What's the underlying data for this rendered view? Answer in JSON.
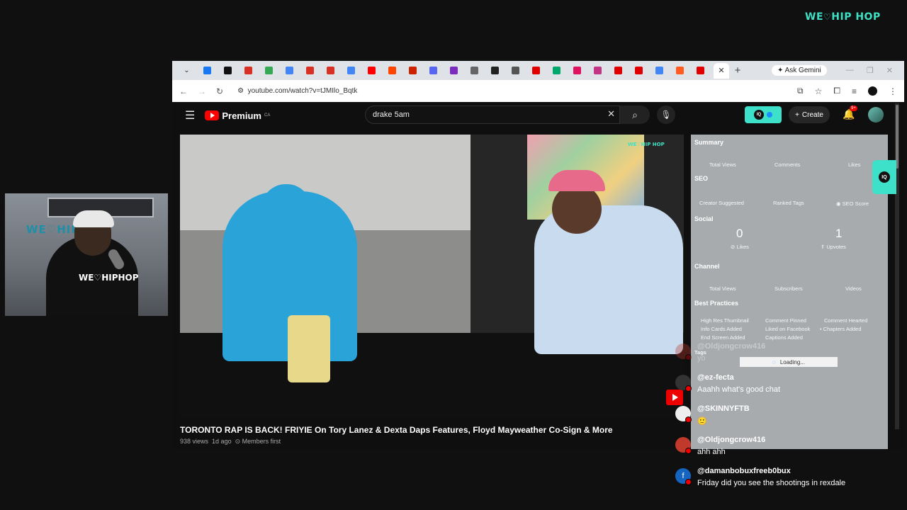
{
  "brand": {
    "left": "WE",
    "heart": "♡",
    "right": "HIP HOP"
  },
  "webcam": {
    "sign": "WE♡HIP HOP",
    "shirt_text": "WE♡HIPHOP"
  },
  "browser": {
    "tab_colors": [
      "#1877f2",
      "#111111",
      "#d93025",
      "#34a853",
      "#4285f4",
      "#d93025",
      "#d93025",
      "#4285f4",
      "#ff0000",
      "#ff4500",
      "#cc2200",
      "#5865f2",
      "#7b2cbf",
      "#666666",
      "#222222",
      "#555555",
      "#e00000",
      "#00a86b",
      "#e0115f",
      "#c13584",
      "#e00000",
      "#e00000",
      "#4285f4",
      "#ff5a1f",
      "#e00000"
    ],
    "active_tab_close": "✕",
    "new_tab": "+",
    "gemini_label": "Ask Gemini",
    "url": "youtube.com/watch?v=tJMIlo_Bqtk"
  },
  "youtube": {
    "logo_text": "Premium",
    "logo_region": "CA",
    "search_value": "drake 5am",
    "create_label": "Create",
    "notif_count": "9+"
  },
  "video": {
    "overlay_logo": "WE♡HIP HOP",
    "title": "TORONTO RAP IS BACK! FRIYIE On Tory Lanez & Dexta Daps Features, Floyd Mayweather Co-Sign & More",
    "views": "938 views",
    "age": "1d ago",
    "members": "Members first"
  },
  "panel": {
    "summary": "Summary",
    "total_views": "Total Views",
    "comments": "Comments",
    "likes": "Likes",
    "seo": "SEO",
    "creator_suggested": "Creator Suggested",
    "ranked_tags": "Ranked Tags",
    "seo_score": "SEO Score",
    "social": "Social",
    "social_likes_value": "0",
    "social_likes_label": "Likes",
    "social_upvotes_value": "1",
    "social_upvotes_label": "Upvotes",
    "channel": "Channel",
    "ch_total_views": "Total Views",
    "ch_subscribers": "Subscribers",
    "ch_videos": "Videos",
    "best_practices": "Best Practices",
    "bp": [
      "High Res Thumbnail",
      "Comment Pinned",
      "Comment Hearted",
      "Info Cards Added",
      "Liked on Facebook",
      "Chapters Added",
      "End Screen Added",
      "Captions Added"
    ],
    "tags_label": "Tags",
    "loading": "Loading..."
  },
  "chat": [
    {
      "name": "@Oldjongcrow416",
      "text": "yo",
      "avatar": "#c0392b"
    },
    {
      "name": "@ez-fecta",
      "text": "Aaahh what's good chat",
      "avatar": "#333333"
    },
    {
      "name": "@SKINNYFTB",
      "text": "🙂",
      "avatar": "#eeeeee"
    },
    {
      "name": "@Oldjongcrow416",
      "text": "ahh ahh",
      "avatar": "#c0392b"
    },
    {
      "name": "@damanbobuxfreeb0bux",
      "text": "Friday did you see the shootings in rexdale",
      "avatar": "#1565c0",
      "initial": "f"
    }
  ]
}
